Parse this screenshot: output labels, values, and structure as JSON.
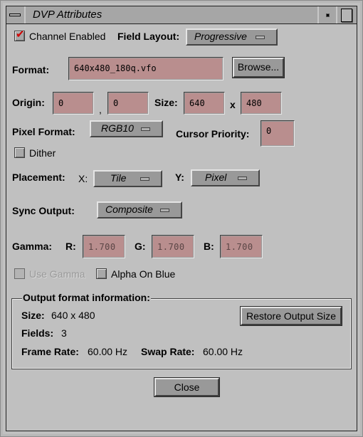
{
  "window": {
    "title": "DVP Attributes",
    "menu_icon": "window-menu-icon",
    "minimize_icon": "minimize-icon",
    "maximize_icon": "maximize-icon"
  },
  "channel_enabled": {
    "label": "Channel Enabled",
    "checked": true
  },
  "field_layout": {
    "label": "Field Layout:",
    "value": "Progressive"
  },
  "format": {
    "label": "Format:",
    "value": "640x480_180q.vfo",
    "browse_label": "Browse..."
  },
  "origin": {
    "label": "Origin:",
    "x": "0",
    "separator": ",",
    "y": "0"
  },
  "size": {
    "label": "Size:",
    "width": "640",
    "separator": "x",
    "height": "480"
  },
  "pixel_format": {
    "label": "Pixel Format:",
    "value": "RGB10"
  },
  "cursor_priority": {
    "label": "Cursor Priority:",
    "value": "0"
  },
  "dither": {
    "label": "Dither",
    "checked": false
  },
  "placement": {
    "label": "Placement:",
    "x_label": "X:",
    "x_value": "Tile",
    "y_label": "Y:",
    "y_value": "Pixel"
  },
  "sync_output": {
    "label": "Sync Output:",
    "value": "Composite"
  },
  "gamma": {
    "label": "Gamma:",
    "r_label": "R:",
    "r_value": "1.700",
    "g_label": "G:",
    "g_value": "1.700",
    "b_label": "B:",
    "b_value": "1.700"
  },
  "use_gamma": {
    "label": "Use Gamma",
    "checked": false,
    "enabled": false
  },
  "alpha_on_blue": {
    "label": "Alpha On Blue",
    "checked": false
  },
  "output_info": {
    "title": "Output format information:",
    "size_label": "Size:",
    "size_value": "640 x 480",
    "fields_label": "Fields:",
    "fields_value": "3",
    "frame_rate_label": "Frame Rate:",
    "frame_rate_value": "60.00 Hz",
    "swap_rate_label": "Swap Rate:",
    "swap_rate_value": "60.00 Hz",
    "restore_label": "Restore Output Size"
  },
  "close_label": "Close",
  "colors": {
    "background": "#c0c0c0",
    "field": "#b98e8e",
    "button": "#999999",
    "check": "#d10000"
  }
}
